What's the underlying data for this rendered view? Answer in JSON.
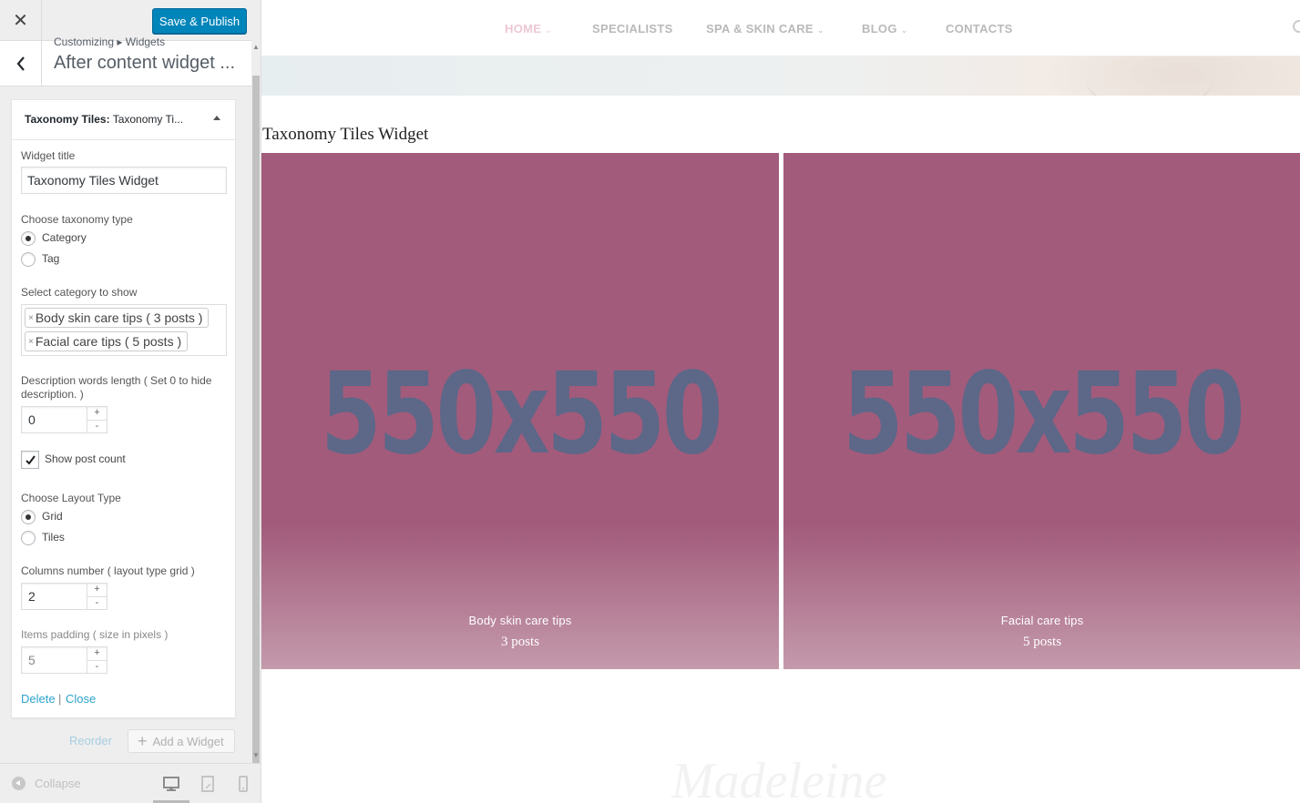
{
  "sidebar": {
    "close_icon": "close-icon",
    "save_label": "Save & Publish",
    "breadcrumb": "Customizing ▸ Widgets",
    "section_title": "After content widget ...",
    "widget": {
      "title_bold": "Taxonomy Tiles:",
      "title_rest": " Taxonomy Ti...",
      "widget_title_label": "Widget title",
      "widget_title_value": "Taxonomy Tiles Widget",
      "taxonomy_type_label": "Choose taxonomy type",
      "taxonomy_options": [
        "Category",
        "Tag"
      ],
      "taxonomy_selected": "Category",
      "category_label": "Select category to show",
      "selected_categories": [
        "Body skin care tips ( 3 posts )",
        "Facial care tips ( 5 posts )"
      ],
      "desc_length_label": "Description words length ( Set 0 to hide description. )",
      "desc_length_value": "0",
      "show_post_count_label": "Show post count",
      "show_post_count_checked": true,
      "layout_type_label": "Choose Layout Type",
      "layout_options": [
        "Grid",
        "Tiles"
      ],
      "layout_selected": "Grid",
      "columns_label": "Columns number ( layout type grid )",
      "columns_value": "2",
      "padding_label": "Items padding ( size in pixels )",
      "padding_value": "5",
      "delete_label": "Delete",
      "separator": "|",
      "close_label": "Close"
    },
    "reorder_label": "Reorder",
    "add_widget_label": "Add a Widget",
    "collapse_label": "Collapse",
    "devices": [
      "desktop-icon",
      "tablet-icon",
      "mobile-icon"
    ],
    "active_device": "desktop"
  },
  "preview": {
    "nav": [
      {
        "label": "HOME",
        "has_dropdown": true,
        "active": true
      },
      {
        "label": "SPECIALISTS",
        "has_dropdown": false,
        "active": false
      },
      {
        "label": "SPA & SKIN CARE",
        "has_dropdown": true,
        "active": false
      },
      {
        "label": "BLOG",
        "has_dropdown": true,
        "active": false
      },
      {
        "label": "CONTACTS",
        "has_dropdown": false,
        "active": false
      }
    ],
    "chevron": "⌄",
    "section_heading": "Taxonomy Tiles Widget",
    "tiles": [
      {
        "placeholder": "550x550",
        "name": "Body skin care tips",
        "count": "3 posts"
      },
      {
        "placeholder": "550x550",
        "name": "Facial care tips",
        "count": "5 posts"
      }
    ],
    "footer_logo": "Madeleine",
    "colors": {
      "accent_button": "#0085ba",
      "tile_bg": "#a25b7b",
      "placeholder_text": "#5d6788",
      "link": "#2ea2cc"
    }
  }
}
